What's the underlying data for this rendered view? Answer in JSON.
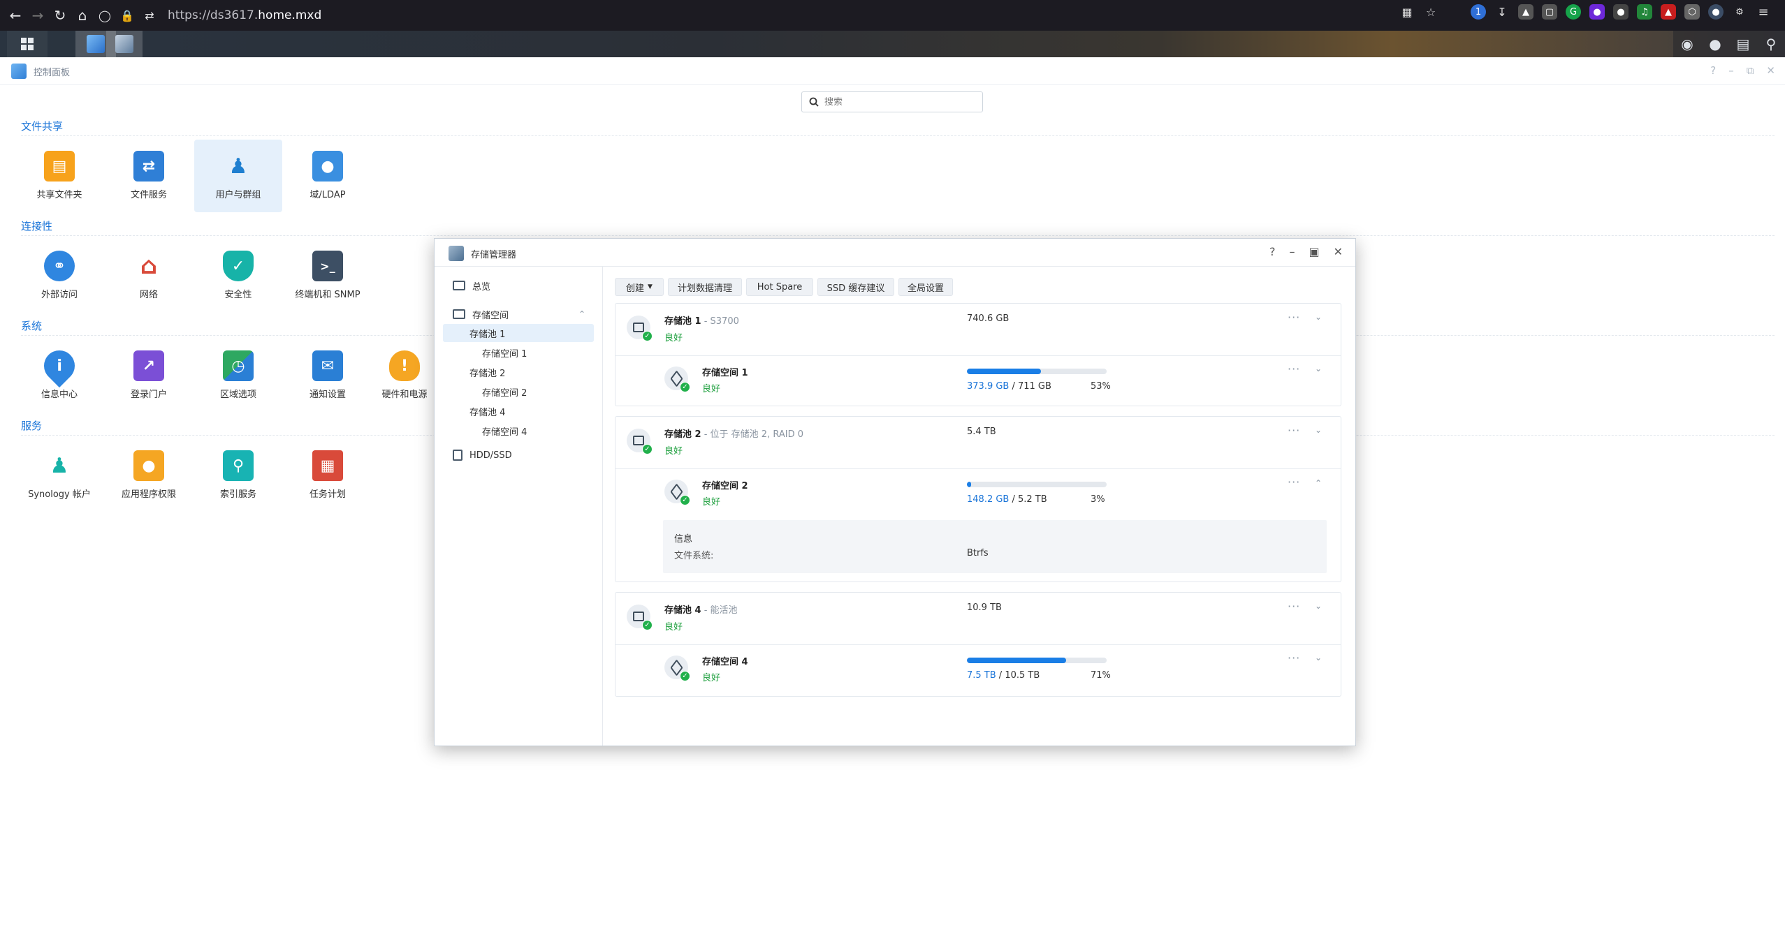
{
  "browser": {
    "url_prefix": "https://ds3617.",
    "url_domain": "home.mxd"
  },
  "control_panel": {
    "title": "控制面板",
    "search_placeholder": "搜索",
    "sections": [
      {
        "title": "文件共享",
        "apps": [
          "共享文件夹",
          "文件服务",
          "用户与群组",
          "域/LDAP"
        ]
      },
      {
        "title": "连接性",
        "apps": [
          "外部访问",
          "网络",
          "安全性",
          "终端机和 SNMP"
        ]
      },
      {
        "title": "系统",
        "apps": [
          "信息中心",
          "登录门户",
          "区域选项",
          "通知设置",
          "硬件和电源"
        ]
      },
      {
        "title": "服务",
        "apps": [
          "Synology 帐户",
          "应用程序权限",
          "索引服务",
          "任务计划"
        ]
      }
    ]
  },
  "storage_manager": {
    "title": "存储管理器",
    "sidebar": {
      "overview": "总览",
      "storage": "存储空间",
      "items": [
        "存储池 1",
        "存储空间 1",
        "存储池 2",
        "存储空间 2",
        "存储池 4",
        "存储空间 4"
      ],
      "hdd": "HDD/SSD"
    },
    "toolbar": {
      "create": "创建",
      "scrub": "计划数据清理",
      "hotspare": "Hot Spare",
      "ssd": "SSD 缓存建议",
      "global": "全局设置"
    },
    "status_good": "良好",
    "pools": [
      {
        "name": "存储池 1",
        "sub": " - S3700",
        "capacity": "740.6 GB",
        "volume": {
          "name": "存储空间 1",
          "used": "373.9 GB",
          "total": " / 711 GB",
          "percent": "53%",
          "fill": 0.53
        }
      },
      {
        "name": "存储池 2",
        "sub": " - 位于 存储池 2, RAID 0",
        "capacity": "5.4 TB",
        "volume": {
          "name": "存储空间 2",
          "used": "148.2 GB",
          "total": " / 5.2 TB",
          "percent": "3%",
          "fill": 0.03
        },
        "info": {
          "title": "信息",
          "fs_label": "文件系统:",
          "fs_value": "Btrfs"
        }
      },
      {
        "name": "存储池 4",
        "sub": " - 能活池",
        "capacity": "10.9 TB",
        "volume": {
          "name": "存储空间 4",
          "used": "7.5 TB",
          "total": " / 10.5 TB",
          "percent": "71%",
          "fill": 0.71
        }
      }
    ]
  }
}
